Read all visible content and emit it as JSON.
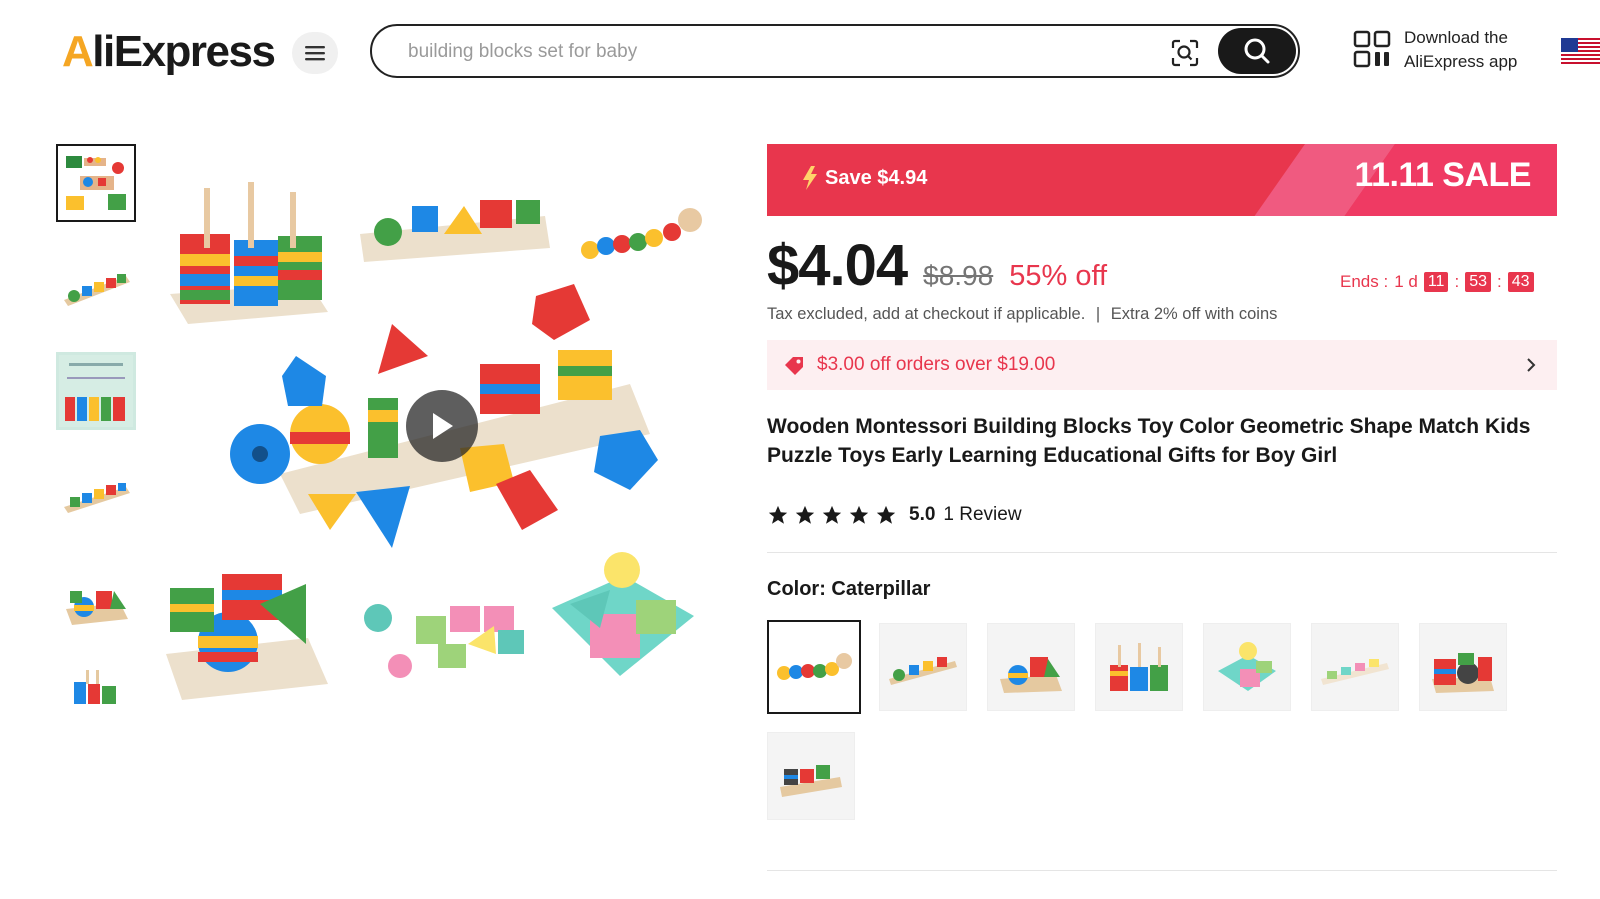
{
  "header": {
    "logo_prefix": "A",
    "logo_rest": "liExpress",
    "search_placeholder": "building blocks set for baby",
    "download_line1": "Download the",
    "download_line2": "AliExpress app",
    "icons": [
      "menu-icon",
      "camera-search-icon",
      "search-icon",
      "qr-code-icon",
      "us-flag-icon"
    ]
  },
  "gallery": {
    "thumbnail_count": 6,
    "selected_index": 0,
    "play_icon": "play-icon"
  },
  "promo": {
    "save_text": "Save $4.94",
    "sale_label": "11.11 SALE",
    "accent_color": "#e8364d"
  },
  "pricing": {
    "price": "$4.04",
    "original_price": "$8.98",
    "discount": "55% off",
    "ends_label": "Ends :",
    "ends_days": "1 d",
    "hours": "11",
    "minutes": "53",
    "seconds": "43",
    "tax_note": "Tax excluded, add at checkout if applicable.",
    "separator": "|",
    "coins_note": "Extra 2% off with coins"
  },
  "coupon": {
    "text": "$3.00 off orders over $19.00"
  },
  "product": {
    "title": "Wooden Montessori Building Blocks Toy Color Geometric Shape Match Kids Puzzle Toys Early Learning Educational Gifts for Boy Girl",
    "rating": "5.0",
    "stars": 5,
    "review_count": "1 Review"
  },
  "variants": {
    "label": "Color: Caterpillar",
    "selected_index": 0,
    "count": 8
  }
}
